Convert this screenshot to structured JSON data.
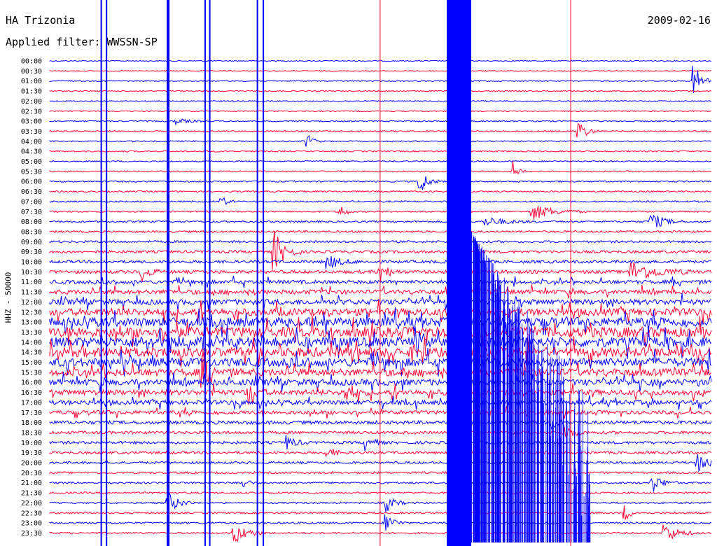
{
  "header": {
    "station": "HA Trizonia",
    "filter": "Applied filter: WWSSN-SP",
    "date": "2009-02-16",
    "channel": "HHZ - 50000"
  },
  "colors": {
    "trace_a": "#0000ff",
    "trace_b": "#ff0033",
    "background": "#ffffff"
  },
  "chart_data": {
    "type": "line",
    "title": "HA Trizonia",
    "subtitle": "Applied filter: WWSSN-SP",
    "ylabel": "HHZ - 50000",
    "y_tick_labels": [
      "00:00",
      "00:30",
      "01:00",
      "01:30",
      "02:00",
      "02:30",
      "03:00",
      "03:30",
      "04:00",
      "04:30",
      "05:00",
      "05:30",
      "06:00",
      "06:30",
      "07:00",
      "07:30",
      "08:00",
      "08:30",
      "09:00",
      "09:30",
      "10:00",
      "10:30",
      "11:00",
      "11:30",
      "12:00",
      "12:30",
      "13:00",
      "13:30",
      "14:00",
      "14:30",
      "15:00",
      "15:30",
      "16:00",
      "16:30",
      "17:00",
      "17:30",
      "18:00",
      "18:30",
      "19:00",
      "19:30",
      "20:00",
      "20:30",
      "21:00",
      "21:30",
      "22:00",
      "22:30",
      "23:00",
      "23:30"
    ],
    "series": [
      {
        "color": "#0000ff",
        "rows": "even (00:00, 01:00, ...)"
      },
      {
        "color": "#ff0033",
        "rows": "odd (00:30, 01:30, ...)"
      }
    ],
    "noise_profile": [
      0.05,
      0.05,
      0.05,
      0.06,
      0.06,
      0.06,
      0.07,
      0.07,
      0.07,
      0.08,
      0.08,
      0.08,
      0.09,
      0.09,
      0.1,
      0.1,
      0.12,
      0.14,
      0.18,
      0.22,
      0.25,
      0.28,
      0.32,
      0.4,
      0.5,
      0.7,
      0.9,
      1.0,
      1.0,
      0.95,
      0.85,
      0.7,
      0.6,
      0.5,
      0.4,
      0.35,
      0.3,
      0.25,
      0.22,
      0.2,
      0.18,
      0.16,
      0.14,
      0.13,
      0.12,
      0.12,
      0.12,
      0.12
    ],
    "events": [
      {
        "row": 2,
        "x": 0.975,
        "amp": 22,
        "dur": 0.03
      },
      {
        "row": 6,
        "x": 0.19,
        "amp": 4,
        "dur": 0.05
      },
      {
        "row": 8,
        "x": 0.39,
        "amp": 12,
        "dur": 0.02
      },
      {
        "row": 7,
        "x": 0.8,
        "amp": 16,
        "dur": 0.03
      },
      {
        "row": 11,
        "x": 0.7,
        "amp": 14,
        "dur": 0.02
      },
      {
        "row": 12,
        "x": 0.56,
        "amp": 18,
        "dur": 0.03
      },
      {
        "row": 14,
        "x": 0.26,
        "amp": 8,
        "dur": 0.02
      },
      {
        "row": 15,
        "x": 0.44,
        "amp": 10,
        "dur": 0.02
      },
      {
        "row": 15,
        "x": 0.73,
        "amp": 12,
        "dur": 0.08
      },
      {
        "row": 16,
        "x": 0.66,
        "amp": 6,
        "dur": 0.08
      },
      {
        "row": 16,
        "x": 0.91,
        "amp": 12,
        "dur": 0.05
      },
      {
        "row": 19,
        "x": 0.34,
        "amp": 28,
        "dur": 0.04
      },
      {
        "row": 20,
        "x": 0.42,
        "amp": 10,
        "dur": 0.05
      },
      {
        "row": 21,
        "x": 0.14,
        "amp": 12,
        "dur": 0.03
      },
      {
        "row": 21,
        "x": 0.5,
        "amp": 14,
        "dur": 0.03
      },
      {
        "row": 21,
        "x": 0.88,
        "amp": 14,
        "dur": 0.1
      },
      {
        "row": 31,
        "x": 0.23,
        "amp": 22,
        "dur": 0.03
      },
      {
        "row": 33,
        "x": 0.3,
        "amp": 16,
        "dur": 0.03
      },
      {
        "row": 33,
        "x": 0.45,
        "amp": 14,
        "dur": 0.03
      },
      {
        "row": 36,
        "x": 0.76,
        "amp": 10,
        "dur": 0.02
      },
      {
        "row": 37,
        "x": 0.78,
        "amp": 10,
        "dur": 0.03
      },
      {
        "row": 38,
        "x": 0.36,
        "amp": 10,
        "dur": 0.03
      },
      {
        "row": 38,
        "x": 0.48,
        "amp": 10,
        "dur": 0.03
      },
      {
        "row": 39,
        "x": 0.42,
        "amp": 8,
        "dur": 0.03
      },
      {
        "row": 40,
        "x": 0.98,
        "amp": 12,
        "dur": 0.04
      },
      {
        "row": 42,
        "x": 0.29,
        "amp": 12,
        "dur": 0.02
      },
      {
        "row": 42,
        "x": 0.91,
        "amp": 14,
        "dur": 0.04
      },
      {
        "row": 44,
        "x": 0.18,
        "amp": 14,
        "dur": 0.04
      },
      {
        "row": 44,
        "x": 0.51,
        "amp": 12,
        "dur": 0.03
      },
      {
        "row": 45,
        "x": 0.87,
        "amp": 12,
        "dur": 0.02
      },
      {
        "row": 46,
        "x": 0.51,
        "amp": 14,
        "dur": 0.03
      },
      {
        "row": 47,
        "x": 0.28,
        "amp": 14,
        "dur": 0.05
      },
      {
        "row": 47,
        "x": 0.93,
        "amp": 14,
        "dur": 0.05
      }
    ],
    "spikes": [
      {
        "x": 0.08,
        "width": 2,
        "color": "#0000ff"
      },
      {
        "x": 0.088,
        "width": 2,
        "color": "#0000ff"
      },
      {
        "x": 0.18,
        "width": 4,
        "color": "#0000ff"
      },
      {
        "x": 0.237,
        "width": 2,
        "color": "#0000ff"
      },
      {
        "x": 0.244,
        "width": 2,
        "color": "#0000ff"
      },
      {
        "x": 0.316,
        "width": 2,
        "color": "#0000ff"
      },
      {
        "x": 0.325,
        "width": 2,
        "color": "#0000ff"
      },
      {
        "x": 0.502,
        "width": 1,
        "color": "#ff0033"
      },
      {
        "x": 0.63,
        "width": 1,
        "color": "#0000ff"
      },
      {
        "x": 0.79,
        "width": 1,
        "color": "#ff0033"
      }
    ],
    "saturated_block": {
      "x_from": 0.6,
      "x_to": 0.637,
      "color": "#0000ff"
    },
    "grid": false
  }
}
